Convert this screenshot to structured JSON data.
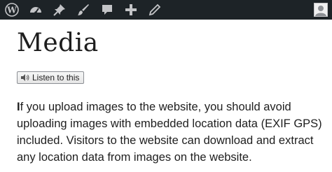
{
  "admin_bar": {
    "icons": [
      "wordpress-icon",
      "dashboard-icon",
      "pin-icon",
      "brush-icon",
      "comment-icon",
      "plus-icon",
      "pencil-icon",
      "avatar-icon"
    ]
  },
  "page": {
    "title": "Media",
    "listen_button_label": "Listen to this",
    "paragraph_first_letter": "I",
    "paragraph_rest": "f you upload images to the website, you should avoid uploading images with embedded location data (EXIF GPS) included. Visitors to the website can download and extract any location data from images on the website."
  },
  "colors": {
    "admin_bar_bg": "#1d2327",
    "admin_bar_icon": "#c3c4c7",
    "text": "#1e1e1e"
  }
}
